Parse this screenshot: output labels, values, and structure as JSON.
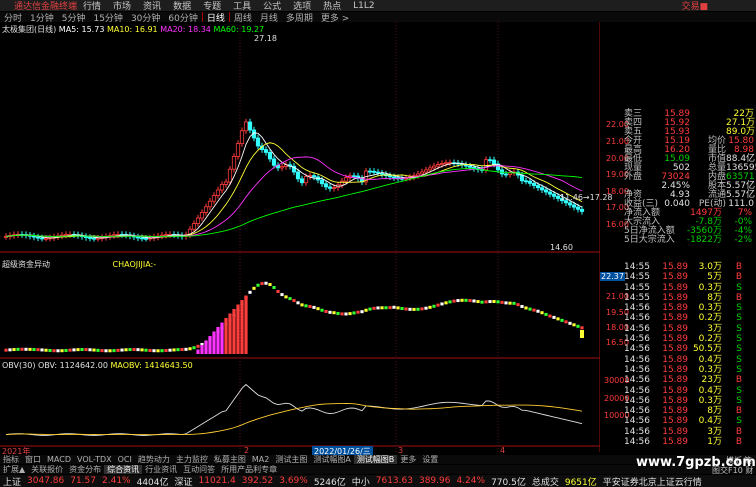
{
  "titlebar": {
    "app_name": "通达信金融终端",
    "menus": [
      "行情",
      "市场",
      "资讯",
      "数据",
      "专题",
      "工具",
      "公式",
      "选项",
      "热点",
      "L1L2"
    ],
    "right_label": "交易■"
  },
  "period_tabs": [
    {
      "label": "分时",
      "active": false
    },
    {
      "label": "1分钟",
      "active": false
    },
    {
      "label": "5分钟",
      "active": false
    },
    {
      "label": "15分钟",
      "active": false
    },
    {
      "label": "30分钟",
      "active": false
    },
    {
      "label": "60分钟",
      "active": false
    },
    {
      "label": "日线",
      "active": true
    },
    {
      "label": "周线",
      "active": false
    },
    {
      "label": "月线",
      "active": false
    },
    {
      "label": "多周期",
      "active": false
    },
    {
      "label": "更多 >",
      "active": false
    }
  ],
  "main_chart": {
    "stock_name": "太极集团(日线)",
    "ma5": "MA5: 15.73",
    "ma10": "MA10: 16.91",
    "ma20": "MA20: 18.34",
    "ma60": "MA60: 19.27",
    "high_label": "27.18",
    "low_label": "14.60",
    "range_label": "11.46→17.28",
    "price_axis": [
      "22.00",
      "21.00",
      "20.00",
      "19.00",
      "18.00",
      "17.00",
      "16.00"
    ]
  },
  "indicator1": {
    "title": "超级资金异动",
    "sub": "CHAOJIJIA:-",
    "price_tag": "22.37",
    "axis": [
      "21.00",
      "19.50",
      "18.00",
      "16.50"
    ]
  },
  "indicator2": {
    "title": "OBV(30)",
    "obv": "OBV: 1124642.00",
    "maobv": "MAOBV: 1414643.50",
    "axis": [
      "30000",
      "20000",
      "10000"
    ]
  },
  "x_axis": {
    "year_label": "2021年",
    "date_label": "2022/01/26/三",
    "tick_2": "2",
    "tick_3": "3",
    "tick_4": "4"
  },
  "quote": {
    "rows": [
      {
        "l": "卖三",
        "v": "15.89",
        "vc": "red",
        "l2": "",
        "v2": "22万",
        "v2c": "yel"
      },
      {
        "l": "卖四",
        "v": "15.92",
        "vc": "red",
        "l2": "",
        "v2": "27.1万",
        "v2c": "yel"
      },
      {
        "l": "卖五",
        "v": "15.93",
        "vc": "red",
        "l2": "",
        "v2": "89.0万",
        "v2c": "yel"
      },
      {
        "l": "今开",
        "v": "15.19",
        "vc": "red",
        "l2": "均价",
        "v2": "15.80",
        "v2c": "red"
      },
      {
        "l": "最高",
        "v": "16.20",
        "vc": "red",
        "l2": "量比",
        "v2": "8.98",
        "v2c": "red"
      },
      {
        "l": "最低",
        "v": "15.09",
        "vc": "grn",
        "l2": "市值",
        "v2": "88.4亿",
        "v2c": "wht"
      },
      {
        "l": "现量",
        "v": "502",
        "vc": "wht",
        "l2": "总量",
        "v2": "136595",
        "v2c": "wht"
      },
      {
        "l": "外盘",
        "v": "73024",
        "vc": "red",
        "l2": "内盘",
        "v2": "63571",
        "v2c": "grn"
      },
      {
        "l": "",
        "v": "2.45%",
        "vc": "wht",
        "l2": "股本",
        "v2": "5.57亿",
        "v2c": "wht"
      },
      {
        "l": "净资",
        "v": "4.93",
        "vc": "wht",
        "l2": "流通",
        "v2": "5.57亿",
        "v2c": "wht"
      },
      {
        "l": "收益(三)",
        "v": "0.040",
        "vc": "wht",
        "l2": "PE(动)",
        "v2": "111.0",
        "v2c": "wht"
      }
    ],
    "flows": [
      {
        "l": "净流入额",
        "v": "1497万",
        "vc": "red",
        "p": "7%",
        "pc": "red"
      },
      {
        "l": "大宗流入",
        "v": "-7.8万",
        "vc": "grn",
        "p": "-0%",
        "pc": "grn"
      },
      {
        "l": "5日净流入额",
        "v": "-3560万",
        "vc": "grn",
        "p": "-4%",
        "pc": "grn"
      },
      {
        "l": "5日大宗流入",
        "v": "-1822万",
        "vc": "grn",
        "p": "-2%",
        "pc": "grn"
      }
    ]
  },
  "ticks": [
    {
      "t": "14:55",
      "p": "15.89",
      "v": "3.0万",
      "d": "B",
      "dc": "red"
    },
    {
      "t": "14:55",
      "p": "15.89",
      "v": "5万",
      "d": "B",
      "dc": "red"
    },
    {
      "t": "14:55",
      "p": "15.89",
      "v": "0.3万",
      "d": "S",
      "dc": "grn"
    },
    {
      "t": "14:55",
      "p": "15.89",
      "v": "8万",
      "d": "B",
      "dc": "red"
    },
    {
      "t": "14:56",
      "p": "15.89",
      "v": "0.3万",
      "d": "S",
      "dc": "grn"
    },
    {
      "t": "14:56",
      "p": "15.89",
      "v": "0.2万",
      "d": "S",
      "dc": "grn"
    },
    {
      "t": "14:56",
      "p": "15.89",
      "v": "3万",
      "d": "S",
      "dc": "grn"
    },
    {
      "t": "14:56",
      "p": "15.89",
      "v": "0.2万",
      "d": "S",
      "dc": "grn"
    },
    {
      "t": "14:56",
      "p": "15.89",
      "v": "50.5万",
      "d": "S",
      "dc": "grn"
    },
    {
      "t": "14:56",
      "p": "15.89",
      "v": "0.4万",
      "d": "S",
      "dc": "grn"
    },
    {
      "t": "14:56",
      "p": "15.89",
      "v": "0.3万",
      "d": "S",
      "dc": "grn"
    },
    {
      "t": "14:56",
      "p": "15.89",
      "v": "23万",
      "d": "B",
      "dc": "red"
    },
    {
      "t": "14:56",
      "p": "15.89",
      "v": "0.4万",
      "d": "S",
      "dc": "grn"
    },
    {
      "t": "14:56",
      "p": "15.89",
      "v": "0.3万",
      "d": "S",
      "dc": "grn"
    },
    {
      "t": "14:56",
      "p": "15.89",
      "v": "8万",
      "d": "B",
      "dc": "red"
    },
    {
      "t": "14:56",
      "p": "15.89",
      "v": "0.4万",
      "d": "S",
      "dc": "grn"
    },
    {
      "t": "14:56",
      "p": "15.89",
      "v": "3万",
      "d": "B",
      "dc": "red"
    },
    {
      "t": "14:56",
      "p": "15.89",
      "v": "1万",
      "d": "B",
      "dc": "red"
    }
  ],
  "bottom_tabs1": [
    {
      "label": "指标",
      "active": false
    },
    {
      "label": "窗口",
      "active": false
    },
    {
      "label": "MACD",
      "active": false
    },
    {
      "label": "VOL-TDX",
      "active": false
    },
    {
      "label": "OCI",
      "active": false
    },
    {
      "label": "趋势动力",
      "active": false
    },
    {
      "label": "主力监控",
      "active": false
    },
    {
      "label": "私募主图",
      "active": false
    },
    {
      "label": "MA2",
      "active": false
    },
    {
      "label": "测试主图",
      "active": false
    },
    {
      "label": "测试幅图A",
      "active": false
    },
    {
      "label": "测试幅图B",
      "active": true
    },
    {
      "label": "更多",
      "active": false
    },
    {
      "label": "设置",
      "active": false
    }
  ],
  "bottom_tabs2": [
    {
      "label": "扩展▲",
      "active": false
    },
    {
      "label": "关联报价",
      "active": false
    },
    {
      "label": "资金分布",
      "active": false
    },
    {
      "label": "综合资讯",
      "active": true
    },
    {
      "label": "行业资讯",
      "active": false
    },
    {
      "label": "互动问答",
      "active": false
    },
    {
      "label": "所用产品利专章",
      "active": false
    }
  ],
  "right_bottom": {
    "l1": "模板",
    "l2": "笔",
    "l3": "图交F10 财"
  },
  "status": [
    {
      "name": "上证",
      "val": "3047.86",
      "chg": "71.57",
      "pct": "2.41%",
      "amt": "4404亿",
      "c": "red"
    },
    {
      "name": "深证",
      "val": "11021.4",
      "chg": "392.52",
      "pct": "3.69%",
      "amt": "5246亿",
      "c": "red"
    },
    {
      "name": "中小",
      "val": "7613.63",
      "chg": "389.96",
      "pct": "4.24%",
      "amt": "770.5亿",
      "c": "red"
    },
    {
      "name": "总成交",
      "val": "9651亿",
      "chg": "",
      "pct": "",
      "amt": "",
      "c": "yel"
    }
  ],
  "status_tail": "平安证券北京上证云行情",
  "watermark": "www.7gpzb.com"
}
